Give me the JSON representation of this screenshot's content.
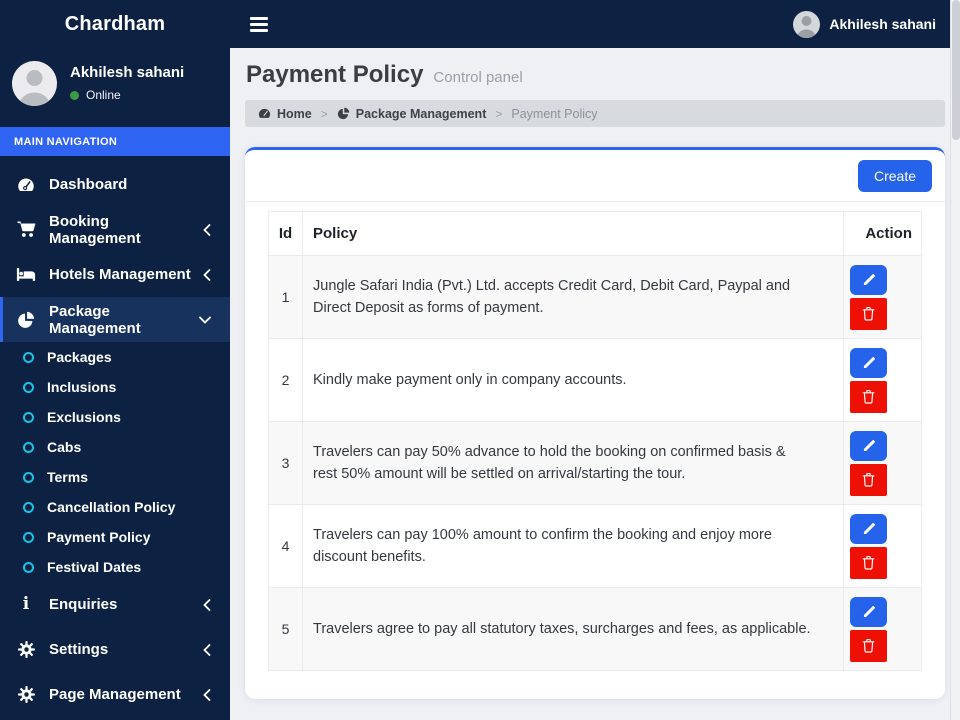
{
  "brand": {
    "title": "Chardham"
  },
  "navbar": {
    "user_name": "Akhilesh sahani",
    "hamburger_icon": "bars-icon"
  },
  "sidebar": {
    "user": {
      "name": "Akhilesh sahani",
      "status": "Online",
      "status_color": "#3d9943"
    },
    "section_label": "MAIN NAVIGATION",
    "items": [
      {
        "label": "Dashboard",
        "icon": "tachometer-icon",
        "chevron": "none",
        "active": false
      },
      {
        "label": "Booking Management",
        "icon": "cart-icon",
        "chevron": "left",
        "active": false
      },
      {
        "label": "Hotels Management",
        "icon": "bed-icon",
        "chevron": "left",
        "active": false
      },
      {
        "label": "Package Management",
        "icon": "pie-chart-icon",
        "chevron": "down",
        "active": true
      },
      {
        "label": "Enquiries",
        "icon": "info-icon",
        "chevron": "left",
        "active": false
      },
      {
        "label": "Settings",
        "icon": "gear-icon",
        "chevron": "left",
        "active": false
      },
      {
        "label": "Page Management",
        "icon": "gear-icon",
        "chevron": "left",
        "active": false
      }
    ],
    "submenu": [
      "Packages",
      "Inclusions",
      "Exclusions",
      "Cabs",
      "Terms",
      "Cancellation Policy",
      "Payment Policy",
      "Festival Dates"
    ]
  },
  "content": {
    "title": "Payment Policy",
    "subtitle": "Control panel",
    "breadcrumb": [
      {
        "label": "Home",
        "icon": "dashboard-icon"
      },
      {
        "label": "Package Management",
        "icon": "pie-chart-icon"
      },
      {
        "label": "Payment Policy",
        "icon": "none"
      }
    ],
    "create_button": "Create",
    "table": {
      "headers": [
        "Id",
        "Policy",
        "Action"
      ],
      "rows": [
        {
          "id": "1",
          "policy": "Jungle Safari India (Pvt.) Ltd. accepts Credit Card, Debit Card, Paypal and Direct Deposit as forms of payment."
        },
        {
          "id": "2",
          "policy": "Kindly make payment only in company accounts."
        },
        {
          "id": "3",
          "policy": "Travelers can pay 50% advance to hold the booking on confirmed basis & rest 50% amount will be settled on arrival/starting the tour."
        },
        {
          "id": "4",
          "policy": "Travelers can pay 100% amount to confirm the booking and enjoy more discount benefits."
        },
        {
          "id": "5",
          "policy": "Travelers agree to pay all statutory taxes, surcharges and fees, as applicable."
        }
      ],
      "row_actions": [
        "edit",
        "delete"
      ]
    }
  },
  "colors": {
    "sidebar_bg": "#0d2242",
    "navbar_bg": "#0d2242",
    "active_item_bg": "#17335d",
    "accent_blue": "#2563eb",
    "section_blue": "#2f64f2",
    "cyan_bullet": "#17c3e6",
    "danger_red": "#ef1005",
    "content_bg": "#eef0f4",
    "breadcrumb_bg": "#d7dadf",
    "stripe_bg": "#f8f8f9",
    "online_green": "#3d9943"
  }
}
